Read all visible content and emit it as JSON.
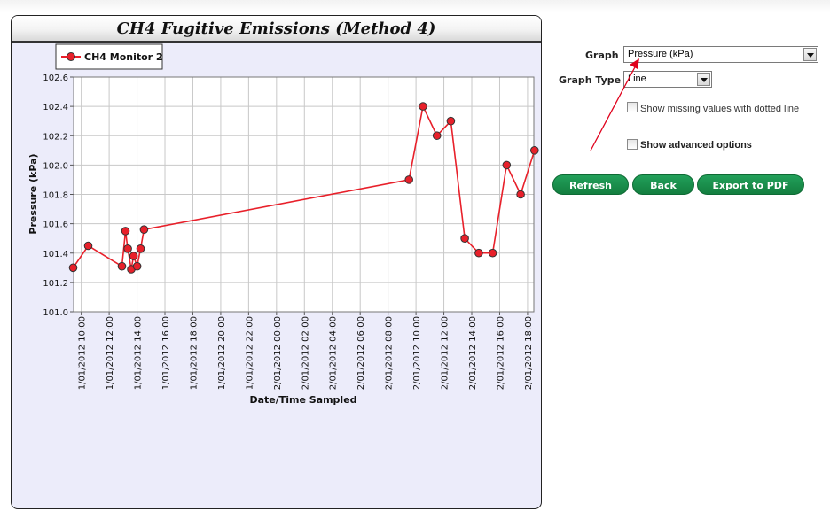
{
  "chart_data": {
    "type": "line",
    "title": "CH4 Fugitive Emissions (Method 4)",
    "xlabel": "Date/Time Sampled",
    "ylabel": "Pressure (kPa)",
    "ylim": [
      101.0,
      102.6
    ],
    "y_ticks": [
      "101.0",
      "101.2",
      "101.4",
      "101.6",
      "101.8",
      "102.0",
      "102.2",
      "102.4",
      "102.6"
    ],
    "x_ticks": [
      "1/01/2012 10:00",
      "1/01/2012 12:00",
      "1/01/2012 14:00",
      "1/01/2012 16:00",
      "1/01/2012 18:00",
      "1/01/2012 20:00",
      "1/01/2012 22:00",
      "2/01/2012 00:00",
      "2/01/2012 02:00",
      "2/01/2012 04:00",
      "2/01/2012 06:00",
      "2/01/2012 08:00",
      "2/01/2012 10:00",
      "2/01/2012 12:00",
      "2/01/2012 14:00",
      "2/01/2012 16:00",
      "2/01/2012 18:00"
    ],
    "grid": true,
    "legend": "top-left",
    "series": [
      {
        "name": "CH4 Monitor 2",
        "color": "#e8202a",
        "x": [
          "1/01/2012 09:25",
          "1/01/2012 10:30",
          "1/01/2012 12:55",
          "1/01/2012 13:10",
          "1/01/2012 13:20",
          "1/01/2012 13:35",
          "1/01/2012 13:45",
          "1/01/2012 14:00",
          "1/01/2012 14:15",
          "1/01/2012 14:30",
          "2/01/2012 09:30",
          "2/01/2012 10:30",
          "2/01/2012 11:30",
          "2/01/2012 12:30",
          "2/01/2012 13:30",
          "2/01/2012 14:30",
          "2/01/2012 15:30",
          "2/01/2012 16:30",
          "2/01/2012 17:30",
          "2/01/2012 18:30"
        ],
        "y": [
          101.3,
          101.45,
          101.31,
          101.55,
          101.43,
          101.29,
          101.38,
          101.31,
          101.43,
          101.56,
          101.9,
          102.4,
          102.2,
          102.3,
          101.5,
          101.4,
          101.4,
          102.0,
          101.8,
          102.1
        ]
      }
    ]
  },
  "controls": {
    "graph_label": "Graph",
    "graph_value": "Pressure (kPa)",
    "graph_type_label": "Graph Type",
    "graph_type_value": "Line",
    "show_missing_label": "Show missing values with dotted line",
    "show_advanced_label": "Show advanced options"
  },
  "buttons": {
    "refresh": "Refresh",
    "back": "Back",
    "export": "Export to PDF"
  },
  "colors": {
    "accent_green": "#189149",
    "annotation_red": "#e0001b",
    "chart_background": "#ececfa"
  }
}
